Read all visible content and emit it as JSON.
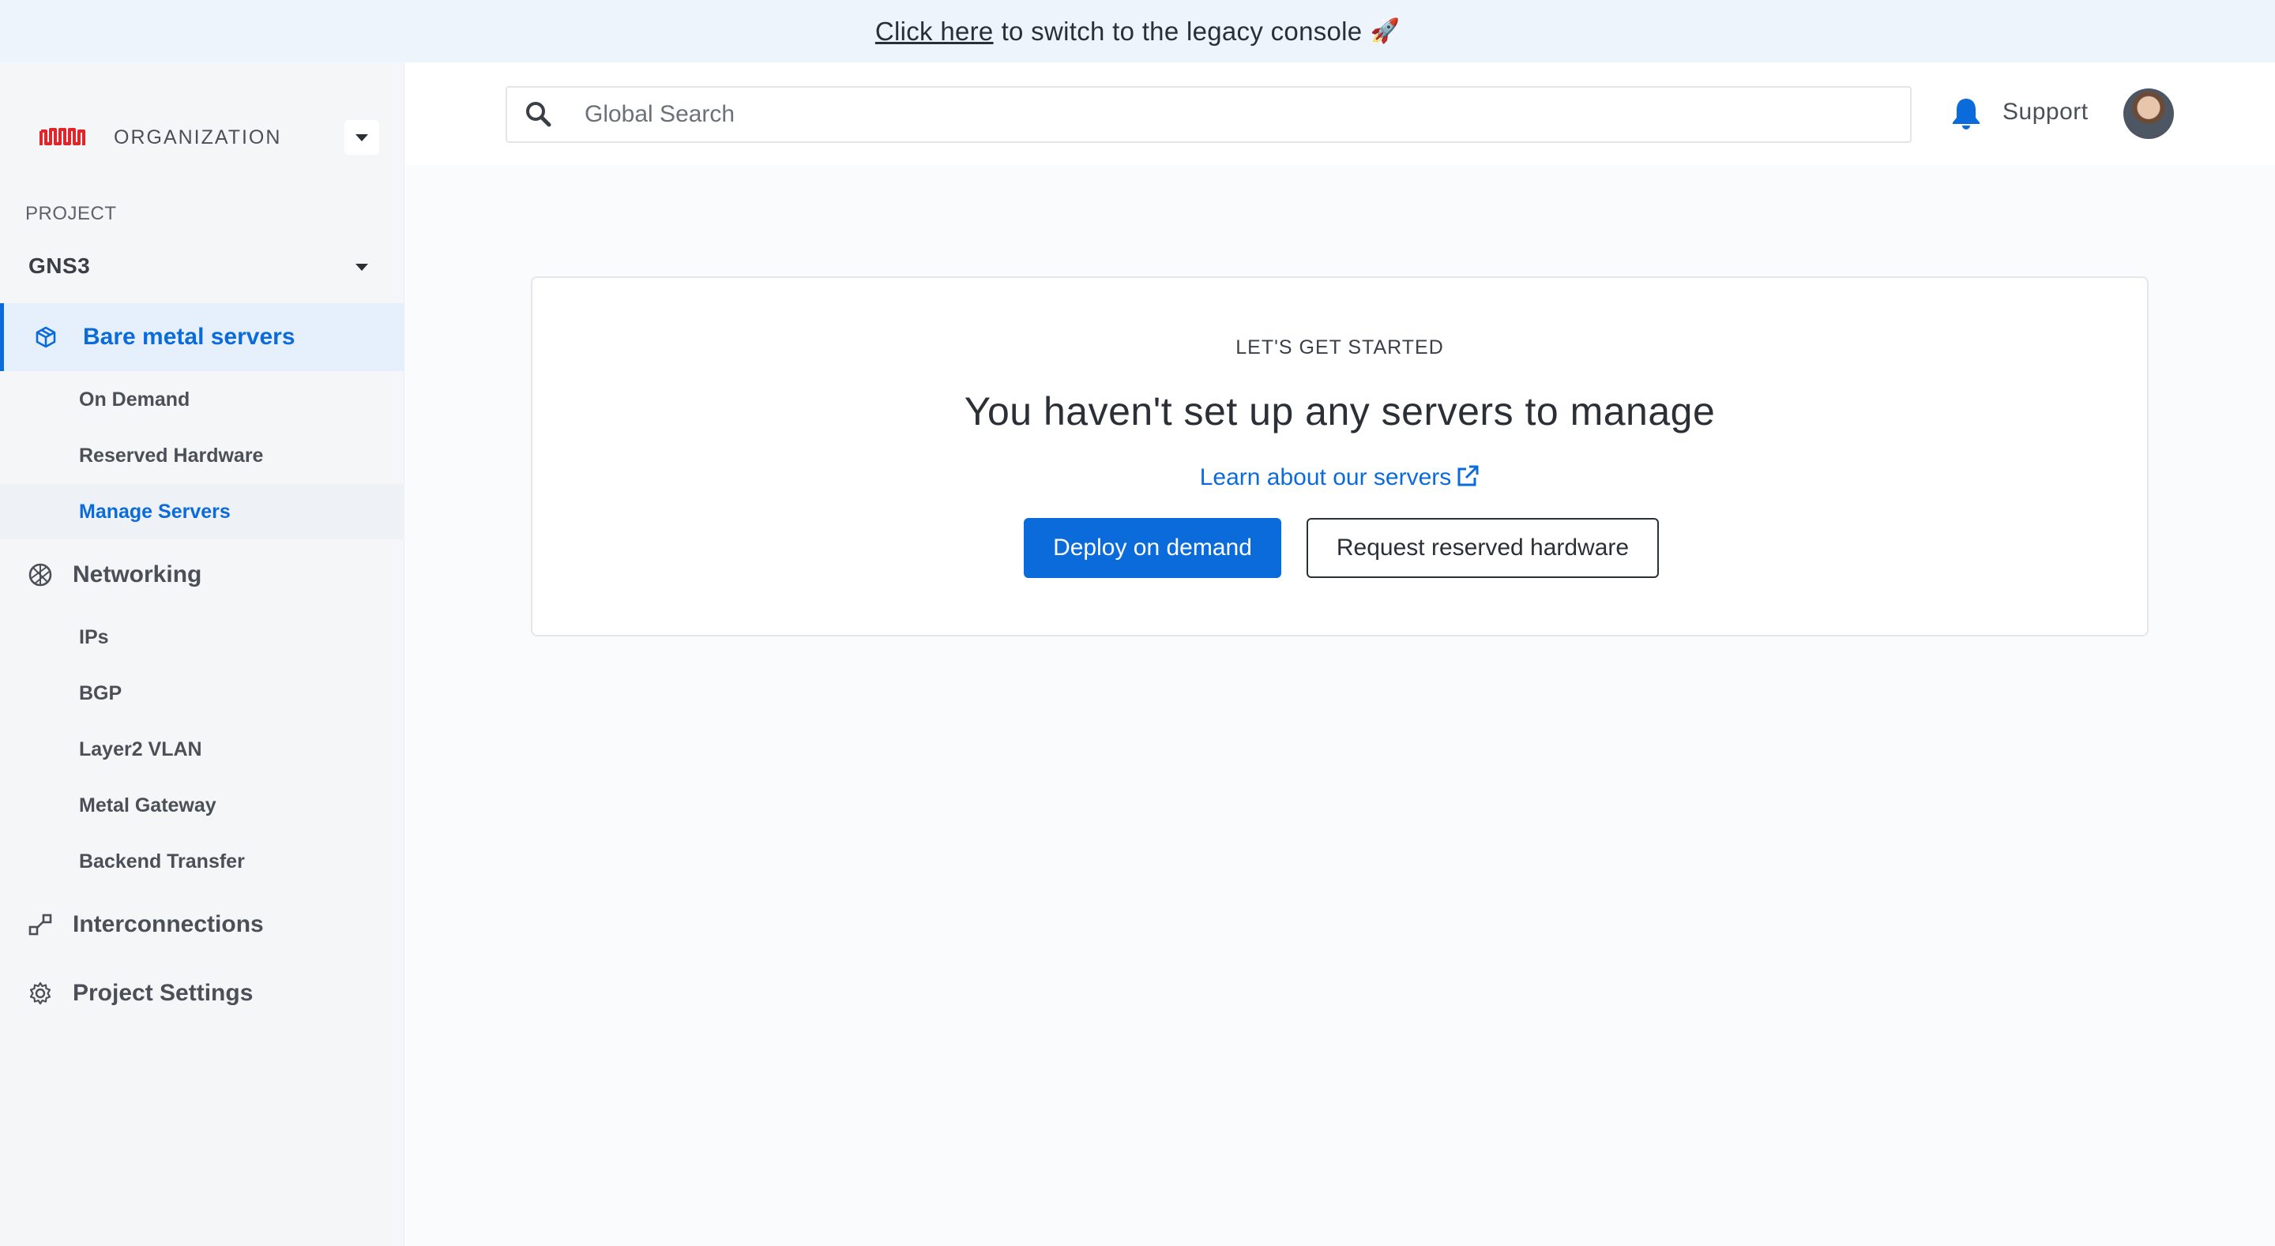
{
  "banner": {
    "link_text": "Click here",
    "text": "to switch to the legacy console",
    "emoji": "🚀"
  },
  "sidebar": {
    "organization_label": "ORGANIZATION",
    "project_label": "PROJECT",
    "project_name": "GNS3",
    "items": [
      {
        "label": "Bare metal servers",
        "icon": "cube-icon",
        "active": true
      },
      {
        "label": "Networking",
        "icon": "network-icon"
      },
      {
        "label": "Interconnections",
        "icon": "interconnection-icon"
      },
      {
        "label": "Project Settings",
        "icon": "gear-icon"
      }
    ],
    "bare_metal_sub": [
      "On Demand",
      "Reserved Hardware",
      "Manage Servers"
    ],
    "networking_sub": [
      "IPs",
      "BGP",
      "Layer2 VLAN",
      "Metal Gateway",
      "Backend Transfer"
    ],
    "selected_sub": "Manage Servers"
  },
  "header": {
    "search_placeholder": "Global Search",
    "support_label": "Support"
  },
  "main": {
    "eyebrow": "LET'S GET STARTED",
    "headline": "You haven't set up any servers to manage",
    "learn_link": "Learn about our servers",
    "primary_button": "Deploy on demand",
    "secondary_button": "Request reserved hardware"
  },
  "colors": {
    "accent": "#0b6bdb",
    "banner_bg": "#eef4fc",
    "brand_logo": "#e0252b"
  }
}
